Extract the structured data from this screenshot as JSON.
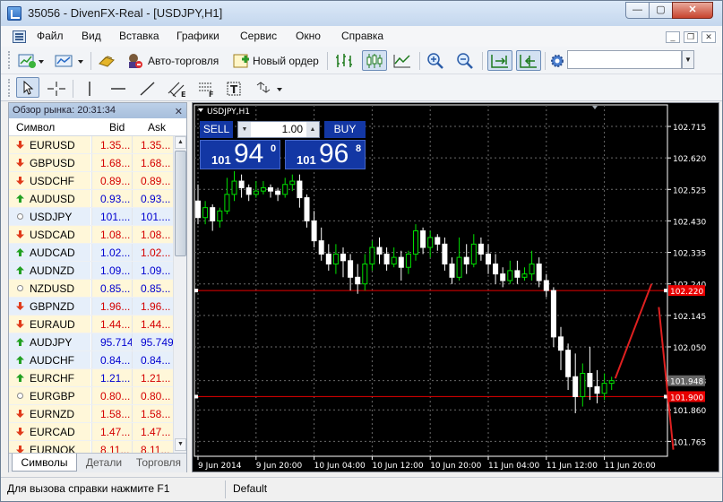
{
  "window": {
    "title": "35056 - DivenFX-Real - [USDJPY,H1]",
    "controls": {
      "minimize": "—",
      "maximize": "▢",
      "close": "✕"
    }
  },
  "menu": {
    "items": [
      "Файл",
      "Вид",
      "Вставка",
      "Графики",
      "Сервис",
      "Окно",
      "Справка"
    ]
  },
  "toolbar": {
    "autotrading_label": "Авто-торговля",
    "new_order_label": "Новый ордер",
    "search_value": ""
  },
  "market_watch": {
    "title": "Обзор рынка: 20:31:34",
    "columns": {
      "symbol": "Символ",
      "bid": "Bid",
      "ask": "Ask"
    },
    "rows": [
      {
        "symbol": "EURUSD",
        "bid": "1.35...",
        "ask": "1.35...",
        "dir": "down",
        "bg": "#fff7d9",
        "color": "#d40000"
      },
      {
        "symbol": "GBPUSD",
        "bid": "1.68...",
        "ask": "1.68...",
        "dir": "down",
        "bg": "#fff7d9",
        "color": "#d40000"
      },
      {
        "symbol": "USDCHF",
        "bid": "0.89...",
        "ask": "0.89...",
        "dir": "down",
        "bg": "#fff7d9",
        "color": "#d40000"
      },
      {
        "symbol": "AUDUSD",
        "bid": "0.93...",
        "ask": "0.93...",
        "dir": "up",
        "bg": "#fff7d9",
        "color": "#0000d0"
      },
      {
        "symbol": "USDJPY",
        "bid": "101....",
        "ask": "101....",
        "dir": "none",
        "bg": "#e6effa",
        "color": "#0000d0"
      },
      {
        "symbol": "USDCAD",
        "bid": "1.08...",
        "ask": "1.08...",
        "dir": "down",
        "bg": "#fff7d9",
        "color": "#d40000"
      },
      {
        "symbol": "AUDCAD",
        "bid": "1.02...",
        "ask": "1.02...",
        "dir": "up",
        "bg": "#e6effa",
        "color": "#0000d0",
        "ask_color": "#d40000"
      },
      {
        "symbol": "AUDNZD",
        "bid": "1.09...",
        "ask": "1.09...",
        "dir": "up",
        "bg": "#e6effa",
        "color": "#0000d0"
      },
      {
        "symbol": "NZDUSD",
        "bid": "0.85...",
        "ask": "0.85...",
        "dir": "none",
        "bg": "#fff7d9",
        "color": "#0000d0"
      },
      {
        "symbol": "GBPNZD",
        "bid": "1.96...",
        "ask": "1.96...",
        "dir": "down",
        "bg": "#e6effa",
        "color": "#d40000"
      },
      {
        "symbol": "EURAUD",
        "bid": "1.44...",
        "ask": "1.44...",
        "dir": "down",
        "bg": "#fff7d9",
        "color": "#d40000"
      },
      {
        "symbol": "AUDJPY",
        "bid": "95.714",
        "ask": "95.749",
        "dir": "up",
        "bg": "#e6effa",
        "color": "#0000d0"
      },
      {
        "symbol": "AUDCHF",
        "bid": "0.84...",
        "ask": "0.84...",
        "dir": "up",
        "bg": "#e6effa",
        "color": "#0000d0"
      },
      {
        "symbol": "EURCHF",
        "bid": "1.21...",
        "ask": "1.21...",
        "dir": "up",
        "bg": "#fff7d9",
        "color": "#0000d0",
        "ask_color": "#d40000"
      },
      {
        "symbol": "EURGBP",
        "bid": "0.80...",
        "ask": "0.80...",
        "dir": "none",
        "bg": "#fff7d9",
        "color": "#d40000"
      },
      {
        "symbol": "EURNZD",
        "bid": "1.58...",
        "ask": "1.58...",
        "dir": "down",
        "bg": "#fff7d9",
        "color": "#d40000"
      },
      {
        "symbol": "EURCAD",
        "bid": "1.47...",
        "ask": "1.47...",
        "dir": "down",
        "bg": "#fff7d9",
        "color": "#d40000"
      },
      {
        "symbol": "EURNOK",
        "bid": "8.11...",
        "ask": "8.11...",
        "dir": "down",
        "bg": "#fff7d9",
        "color": "#d40000"
      }
    ],
    "tabs": [
      "Символы",
      "Детали",
      "Торговля"
    ]
  },
  "trade_panel": {
    "sell_label": "SELL",
    "buy_label": "BUY",
    "lot": "1.00",
    "sell_price": {
      "prefix": "101",
      "big": "94",
      "sup": "0"
    },
    "buy_price": {
      "prefix": "101",
      "big": "96",
      "sup": "8"
    }
  },
  "chart_data": {
    "type": "candlestick",
    "title": "USDJPY,H1",
    "ylim": [
      101.72,
      102.78
    ],
    "y_ticks": [
      "102.715",
      "102.620",
      "102.525",
      "102.430",
      "102.335",
      "102.240",
      "102.145",
      "102.050",
      "101.948",
      "101.860",
      "101.765"
    ],
    "x_ticks": [
      "9 Jun 2014",
      "9 Jun 20:00",
      "10 Jun 04:00",
      "10 Jun 12:00",
      "10 Jun 20:00",
      "11 Jun 04:00",
      "11 Jun 12:00",
      "11 Jun 20:00"
    ],
    "price_labels": [
      {
        "label": "102.220",
        "value": 102.22,
        "color": "#e80000"
      },
      {
        "label": "101.948",
        "value": 101.948,
        "color": "#666666"
      },
      {
        "label": "101.900",
        "value": 101.9,
        "color": "#e80000"
      }
    ],
    "hlines": [
      102.22,
      101.9
    ],
    "candles": [
      [
        102.49,
        102.44,
        102.54,
        102.42
      ],
      [
        102.44,
        102.47,
        102.49,
        102.42
      ],
      [
        102.47,
        102.43,
        102.48,
        102.4
      ],
      [
        102.43,
        102.46,
        102.47,
        102.41
      ],
      [
        102.46,
        102.51,
        102.56,
        102.45
      ],
      [
        102.51,
        102.55,
        102.58,
        102.49
      ],
      [
        102.55,
        102.53,
        102.57,
        102.5
      ],
      [
        102.53,
        102.51,
        102.54,
        102.49
      ],
      [
        102.51,
        102.52,
        102.55,
        102.5
      ],
      [
        102.52,
        102.53,
        102.55,
        102.51
      ],
      [
        102.53,
        102.52,
        102.54,
        102.5
      ],
      [
        102.52,
        102.51,
        102.53,
        102.49
      ],
      [
        102.51,
        102.54,
        102.56,
        102.5
      ],
      [
        102.54,
        102.55,
        102.57,
        102.52
      ],
      [
        102.55,
        102.5,
        102.57,
        102.47
      ],
      [
        102.5,
        102.43,
        102.51,
        102.41
      ],
      [
        102.43,
        102.37,
        102.46,
        102.35
      ],
      [
        102.37,
        102.33,
        102.41,
        102.31
      ],
      [
        102.33,
        102.3,
        102.36,
        102.28
      ],
      [
        102.3,
        102.33,
        102.36,
        102.27
      ],
      [
        102.33,
        102.31,
        102.35,
        102.26
      ],
      [
        102.31,
        102.26,
        102.33,
        102.22
      ],
      [
        102.26,
        102.24,
        102.3,
        102.21
      ],
      [
        102.24,
        102.3,
        102.33,
        102.22
      ],
      [
        102.3,
        102.35,
        102.37,
        102.28
      ],
      [
        102.35,
        102.33,
        102.38,
        102.3
      ],
      [
        102.33,
        102.3,
        102.35,
        102.28
      ],
      [
        102.3,
        102.32,
        102.35,
        102.29
      ],
      [
        102.32,
        102.29,
        102.34,
        102.25
      ],
      [
        102.29,
        102.33,
        102.34,
        102.27
      ],
      [
        102.33,
        102.4,
        102.42,
        102.31
      ],
      [
        102.4,
        102.35,
        102.41,
        102.33
      ],
      [
        102.35,
        102.38,
        102.4,
        102.32
      ],
      [
        102.38,
        102.36,
        102.39,
        102.34
      ],
      [
        102.36,
        102.3,
        102.38,
        102.28
      ],
      [
        102.3,
        102.26,
        102.32,
        102.24
      ],
      [
        102.26,
        102.32,
        102.38,
        102.25
      ],
      [
        102.32,
        102.3,
        102.36,
        102.27
      ],
      [
        102.3,
        102.36,
        102.39,
        102.29
      ],
      [
        102.36,
        102.33,
        102.38,
        102.31
      ],
      [
        102.33,
        102.3,
        102.36,
        102.27
      ],
      [
        102.3,
        102.27,
        102.33,
        102.24
      ],
      [
        102.27,
        102.25,
        102.29,
        102.23
      ],
      [
        102.25,
        102.28,
        102.31,
        102.24
      ],
      [
        102.28,
        102.26,
        102.31,
        102.24
      ],
      [
        102.26,
        102.27,
        102.29,
        102.25
      ],
      [
        102.27,
        102.3,
        102.34,
        102.25
      ],
      [
        102.3,
        102.25,
        102.32,
        102.23
      ],
      [
        102.25,
        102.22,
        102.27,
        102.2
      ],
      [
        102.22,
        102.08,
        102.23,
        102.05
      ],
      [
        102.08,
        102.04,
        102.11,
        101.98
      ],
      [
        102.04,
        101.96,
        102.06,
        101.92
      ],
      [
        101.96,
        101.9,
        102.03,
        101.85
      ],
      [
        101.9,
        101.97,
        102.0,
        101.87
      ],
      [
        101.97,
        101.93,
        102.05,
        101.89
      ],
      [
        101.93,
        101.91,
        101.98,
        101.88
      ],
      [
        101.91,
        101.94,
        101.97,
        101.89
      ],
      [
        101.94,
        101.948,
        101.96,
        101.92
      ]
    ],
    "annotation_lines": [
      {
        "from": [
          57.5,
          101.955
        ],
        "to": [
          62.5,
          102.24
        ],
        "color": "#e02020"
      },
      {
        "from": [
          63.5,
          102.17
        ],
        "to": [
          65.5,
          101.74
        ],
        "color": "#e02020"
      }
    ],
    "colors": {
      "bg": "#000000",
      "grid": "#6a6a6a",
      "axis": "#ffffff",
      "bull": "#00e000",
      "bear": "#ffffff"
    }
  },
  "status_bar": {
    "help": "Для вызова справки нажмите F1",
    "profile": "Default"
  }
}
